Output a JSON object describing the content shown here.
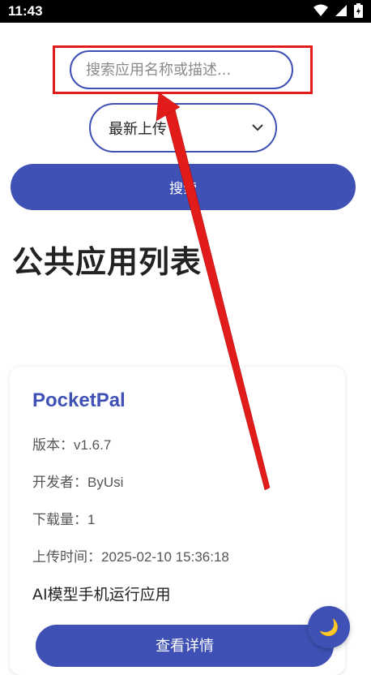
{
  "status_bar": {
    "time": "11:43"
  },
  "search": {
    "placeholder": "搜索应用名称或描述..."
  },
  "sort": {
    "selected": "最新上传"
  },
  "search_button_label": "搜索",
  "page_title": "公共应用列表",
  "apps": [
    {
      "name": "PocketPal",
      "version_label": "版本：",
      "version": "v1.6.7",
      "developer_label": "开发者：",
      "developer": "ByUsi",
      "downloads_label": "下载量：",
      "downloads": "1",
      "upload_time_label": "上传时间：",
      "upload_time": "2025-02-10 15:36:18",
      "description": "AI模型手机运行应用",
      "details_button": "查看详情"
    }
  ],
  "theme_toggle_icon": "🌙",
  "colors": {
    "primary": "#3f51b5",
    "highlight": "#e21b1b"
  }
}
